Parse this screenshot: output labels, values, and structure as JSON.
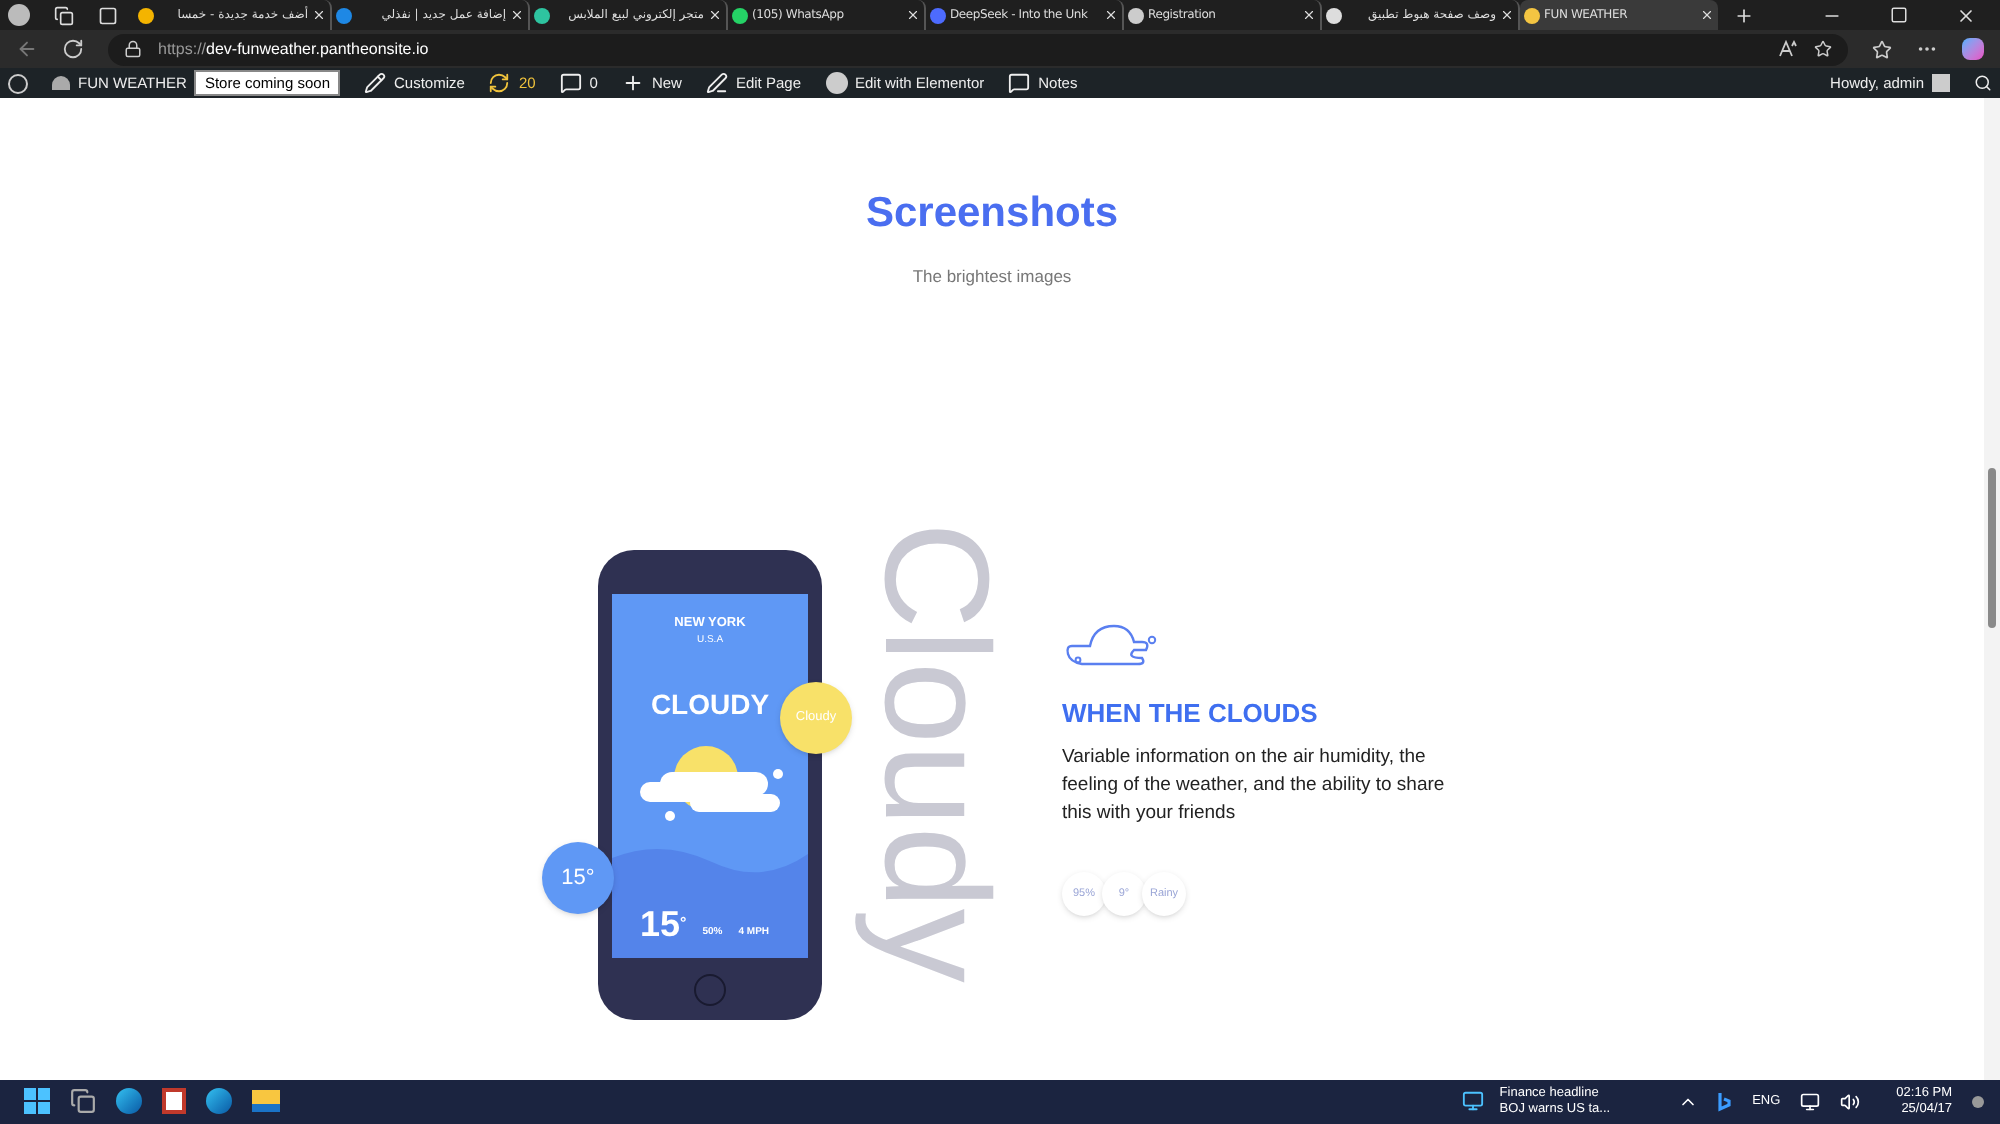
{
  "browser": {
    "tabs": [
      {
        "label": "أضف خدمة جديدة - خمسا",
        "selected": false,
        "color": "#f4b400"
      },
      {
        "label": "إضافة عمل جديد | نفذلي",
        "selected": false,
        "color": "#1e88e5"
      },
      {
        "label": "متجر إلكتروني لبيع الملابس",
        "selected": false,
        "color": "#2ec4a0"
      },
      {
        "label": "(105) WhatsApp",
        "selected": false,
        "color": "#25d366"
      },
      {
        "label": "DeepSeek - Into the Unk",
        "selected": false,
        "color": "#4d6bfe"
      },
      {
        "label": "Registration",
        "selected": false,
        "color": "#cccccc"
      },
      {
        "label": "وصف صفحة هبوط تطبيق",
        "selected": false,
        "color": "#dddddd"
      },
      {
        "label": "FUN WEATHER",
        "selected": true,
        "color": "#f4c542"
      }
    ],
    "url_prefix": "https://",
    "url_host": "dev-funweather.pantheonsite.io"
  },
  "admin_bar": {
    "site": "FUN WEATHER",
    "badge": "Store coming soon",
    "items": [
      {
        "kind": "customize",
        "label": "Customize"
      },
      {
        "kind": "updates",
        "label": "20"
      },
      {
        "kind": "comments",
        "label": "0"
      },
      {
        "kind": "new",
        "label": "New"
      },
      {
        "kind": "edit",
        "label": "Edit Page"
      },
      {
        "kind": "elementor",
        "label": "Edit with Elementor"
      },
      {
        "kind": "notes",
        "label": "Notes"
      }
    ],
    "greeting": "Howdy, admin"
  },
  "section": {
    "title": "Screenshots",
    "subtitle": "The brightest images"
  },
  "phone": {
    "background_word": "Cloudy",
    "city": "NEW YORK",
    "country": "U.S.A",
    "condition": "CLOUDY",
    "bubble_label": "Cloudy",
    "bubble_temp": "15°",
    "temp": "15",
    "temp_unit": "°",
    "humidity": "50%",
    "wind": "4 MPH"
  },
  "feature": {
    "heading": "WHEN THE CLOUDS",
    "text": "Variable information on the air humidity, the feeling of the weather, and the ability to share this with your friends",
    "chips": [
      "95%",
      "9°",
      "Rainy"
    ]
  },
  "taskbar": {
    "news_title": "Finance headline",
    "news_text": "BOJ warns US ta...",
    "language": "ENG",
    "time": "02:16 PM",
    "date": "25/04/17"
  }
}
